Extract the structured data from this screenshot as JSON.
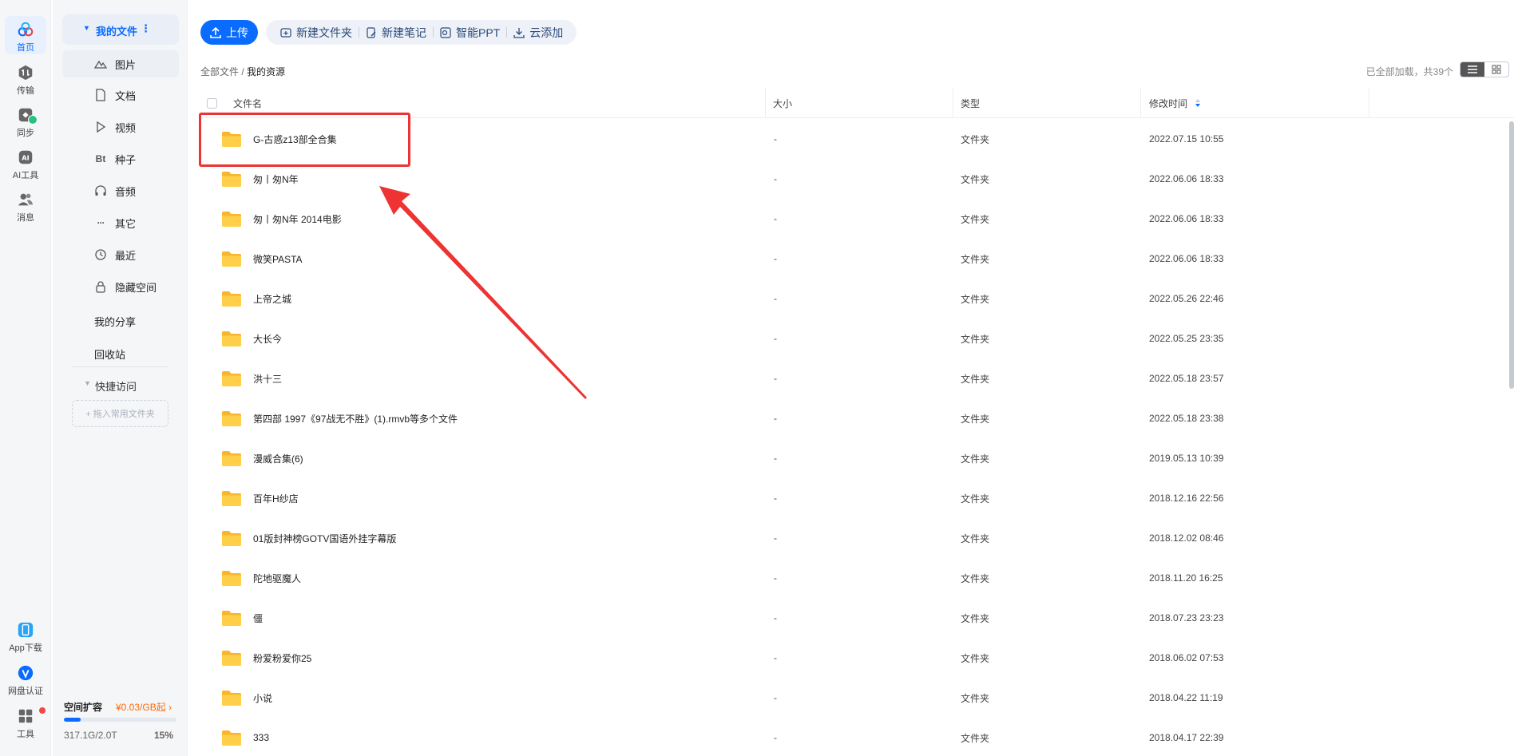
{
  "rail": {
    "home": "首页",
    "transfer": "传输",
    "sync": "同步",
    "ai_tools": "AI工具",
    "messages": "消息",
    "app_download": "App下载",
    "verify": "网盘认证",
    "tools": "工具"
  },
  "sidebar": {
    "my_files": "我的文件",
    "items": [
      {
        "label": "图片",
        "icon": "mountain-icon"
      },
      {
        "label": "文档",
        "icon": "document-icon"
      },
      {
        "label": "视频",
        "icon": "play-icon"
      },
      {
        "label": "种子",
        "icon": "bt-icon"
      },
      {
        "label": "音频",
        "icon": "headphones-icon"
      },
      {
        "label": "其它",
        "icon": "more-icon"
      },
      {
        "label": "最近",
        "icon": "clock-icon"
      },
      {
        "label": "隐藏空间",
        "icon": "lock-icon"
      }
    ],
    "my_share": "我的分享",
    "recycle": "回收站",
    "quick_access": "快捷访问",
    "drop_hint": "+ 拖入常用文件夹",
    "bt_glyph": "Bt",
    "more_glyph": "···"
  },
  "quota": {
    "title": "空间扩容",
    "price": "¥0.03/GB起",
    "chevron": "›",
    "used": "317.1G/2.0T",
    "percent_label": "15%",
    "percent": 15
  },
  "toolbar": {
    "upload": "上传",
    "new_folder": "新建文件夹",
    "new_note": "新建笔记",
    "smart_ppt": "智能PPT",
    "cloud_add": "云添加"
  },
  "breadcrumb": {
    "root": "全部文件",
    "sep": " / ",
    "current": "我的资源"
  },
  "loaded_info": "已全部加载，共39个",
  "table": {
    "headers": {
      "name": "文件名",
      "size": "大小",
      "type": "类型",
      "modified": "修改时间"
    },
    "rows": [
      {
        "name": "G-古惑z13部全合集",
        "size": "-",
        "type": "文件夹",
        "modified": "2022.07.15 10:55"
      },
      {
        "name": "匆丨匆N年",
        "size": "-",
        "type": "文件夹",
        "modified": "2022.06.06 18:33"
      },
      {
        "name": "匆丨匆N年 2014电影",
        "size": "-",
        "type": "文件夹",
        "modified": "2022.06.06 18:33"
      },
      {
        "name": "微笑PASTA",
        "size": "-",
        "type": "文件夹",
        "modified": "2022.06.06 18:33"
      },
      {
        "name": "上帝之城",
        "size": "-",
        "type": "文件夹",
        "modified": "2022.05.26 22:46"
      },
      {
        "name": "大长今",
        "size": "-",
        "type": "文件夹",
        "modified": "2022.05.25 23:35"
      },
      {
        "name": "洪十三",
        "size": "-",
        "type": "文件夹",
        "modified": "2022.05.18 23:57"
      },
      {
        "name": "第四部 1997《97战无不胜》(1).rmvb等多个文件",
        "size": "-",
        "type": "文件夹",
        "modified": "2022.05.18 23:38"
      },
      {
        "name": "漫威合集(6)",
        "size": "-",
        "type": "文件夹",
        "modified": "2019.05.13 10:39"
      },
      {
        "name": "百年H纱店",
        "size": "-",
        "type": "文件夹",
        "modified": "2018.12.16 22:56"
      },
      {
        "name": "01版封神榜GOTV国语外挂字幕版",
        "size": "-",
        "type": "文件夹",
        "modified": "2018.12.02 08:46"
      },
      {
        "name": "陀地驱魔人",
        "size": "-",
        "type": "文件夹",
        "modified": "2018.11.20 16:25"
      },
      {
        "name": "僵",
        "size": "-",
        "type": "文件夹",
        "modified": "2018.07.23 23:23"
      },
      {
        "name": "粉爱粉爱你25",
        "size": "-",
        "type": "文件夹",
        "modified": "2018.06.02 07:53"
      },
      {
        "name": "小说",
        "size": "-",
        "type": "文件夹",
        "modified": "2018.04.22 11:19"
      },
      {
        "name": "333",
        "size": "-",
        "type": "文件夹",
        "modified": "2018.04.17 22:39"
      }
    ]
  },
  "colors": {
    "accent": "#0a6cff",
    "folder": "#ffc233",
    "annotation": "#ee3333",
    "price": "#ff6a00"
  }
}
